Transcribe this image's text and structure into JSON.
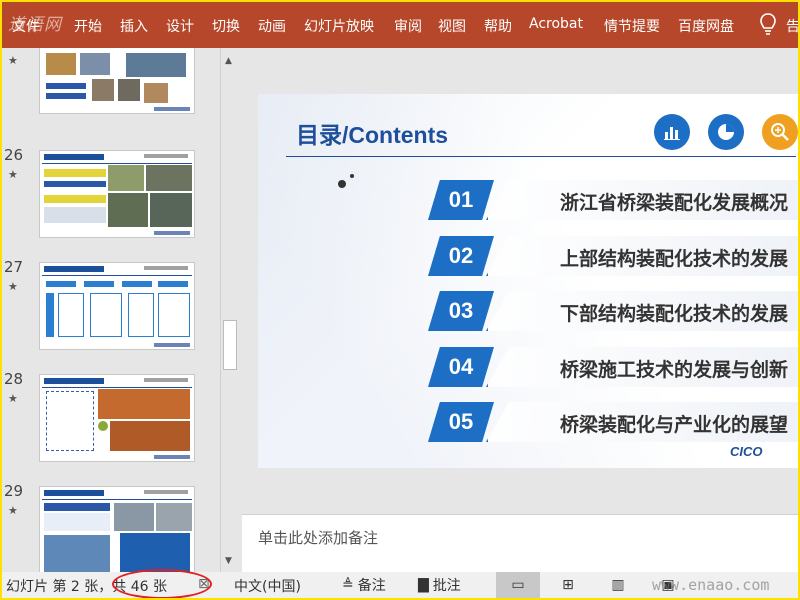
{
  "ribbon": {
    "watermark": "道语网",
    "tabs": [
      "文件",
      "开始",
      "插入",
      "设计",
      "切换",
      "动画",
      "幻灯片放映",
      "审阅",
      "视图",
      "帮助",
      "Acrobat",
      "情节提要",
      "百度网盘"
    ],
    "share_label": "告"
  },
  "thumbnails": {
    "items": [
      {
        "number": "",
        "star": "★"
      },
      {
        "number": "26",
        "star": "★"
      },
      {
        "number": "27",
        "star": "★"
      },
      {
        "number": "28",
        "star": "★"
      },
      {
        "number": "29",
        "star": "★"
      }
    ]
  },
  "slide": {
    "title": "目录/Contents",
    "toc": [
      {
        "num": "01",
        "text": "浙江省桥梁装配化发展概况"
      },
      {
        "num": "02",
        "text": "上部结构装配化技术的发展"
      },
      {
        "num": "03",
        "text": "下部结构装配化技术的发展"
      },
      {
        "num": "04",
        "text": "桥梁施工技术的发展与创新"
      },
      {
        "num": "05",
        "text": "桥梁装配化与产业化的展望"
      }
    ],
    "logo_text": "CICO",
    "icons": [
      "bar-chart-icon",
      "pie-chart-icon",
      "zoom-in-icon"
    ]
  },
  "notes": {
    "placeholder": "单击此处添加备注"
  },
  "status": {
    "slide_info": "幻灯片 第 2 张，共 46 张",
    "language": "中文(中国)",
    "notes_label": "备注",
    "comments_label": "批注",
    "site_watermark": "www.enaao.com"
  },
  "colors": {
    "ribbon": "#b7472a",
    "accent_blue": "#1d6fc5",
    "title_blue": "#1d4f9c",
    "circle_orange": "#f0a020",
    "highlight_border": "#ffe000"
  }
}
